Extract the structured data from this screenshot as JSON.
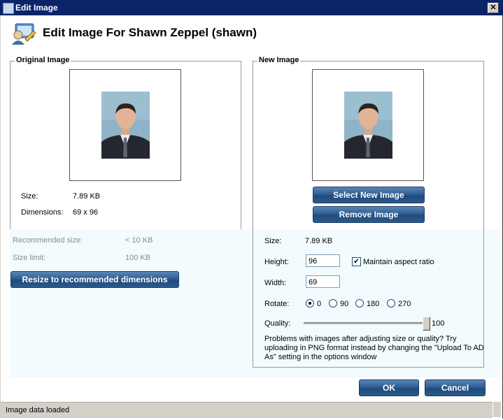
{
  "window": {
    "title": "Edit Image",
    "close_glyph": "✕"
  },
  "heading": {
    "text": "Edit Image For Shawn Zeppel  (shawn)"
  },
  "original": {
    "legend": "Original Image",
    "size_label": "Size:",
    "size_value": "7.89 KB",
    "dims_label": "Dimensions:",
    "dims_value": "69 x 96"
  },
  "limits": {
    "recommended_label": "Recommended size:",
    "recommended_value": "< 10 KB",
    "limit_label": "Size limit:",
    "limit_value": "100 KB",
    "resize_button": "Resize to recommended dimensions"
  },
  "new_image": {
    "legend": "New Image",
    "select_button": "Select New Image",
    "remove_button": "Remove Image",
    "size_label": "Size:",
    "size_value": "7.89 KB",
    "height_label": "Height:",
    "height_value": "96",
    "maintain_label": "Maintain aspect ratio",
    "maintain_checked": true,
    "width_label": "Width:",
    "width_value": "69",
    "rotate_label": "Rotate:",
    "rotate_options": [
      "0",
      "90",
      "180",
      "270"
    ],
    "rotate_selected": "0",
    "quality_label": "Quality:",
    "quality_value": "100",
    "note": "Problems with images after adjusting size or quality? Try uploading in PNG format instead by changing the \"Upload To AD As\" setting in the options window"
  },
  "buttons": {
    "ok": "OK",
    "cancel": "Cancel"
  },
  "status": {
    "text": "Image data loaded"
  },
  "icons": {
    "window_icon": "app-icon",
    "heading_icon": "user-edit-icon",
    "close": "close-icon",
    "check": "checkmark-icon"
  },
  "colors": {
    "titlebar": "#0a246a",
    "button": "#2f5f93",
    "tint": "#f2fbfd"
  }
}
